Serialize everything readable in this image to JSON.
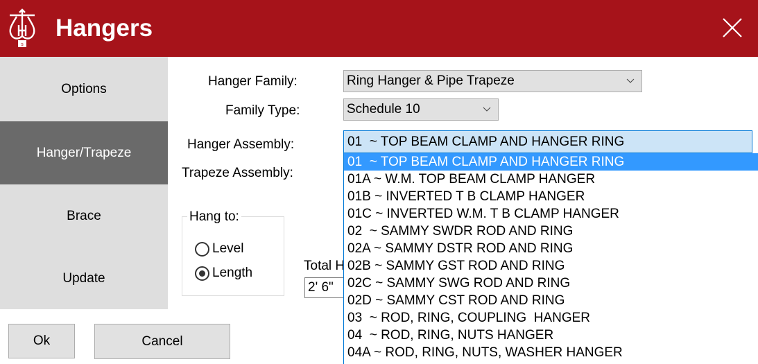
{
  "window": {
    "title": "Hangers",
    "logo_icon": "hanger-logo-icon",
    "close_icon": "close-icon",
    "accent_color": "#a6131a"
  },
  "sidebar": {
    "items": [
      {
        "label": "Options",
        "active": false
      },
      {
        "label": "Hanger/Trapeze",
        "active": true
      },
      {
        "label": "Brace",
        "active": false
      },
      {
        "label": "Update",
        "active": false
      }
    ]
  },
  "form": {
    "hanger_family": {
      "label": "Hanger Family:",
      "value": "Ring Hanger & Pipe Trapeze"
    },
    "family_type": {
      "label": "Family Type:",
      "value": "Schedule 10"
    },
    "hanger_assembly": {
      "label": "Hanger Assembly:",
      "value": "01  ~ TOP BEAM CLAMP AND HANGER RING",
      "options": [
        "01  ~ TOP BEAM CLAMP AND HANGER RING",
        "01A ~ W.M. TOP BEAM CLAMP HANGER",
        "01B ~ INVERTED T B CLAMP HANGER",
        "01C ~ INVERTED W.M. T B CLAMP HANGER",
        "02  ~ SAMMY SWDR ROD AND RING",
        "02A ~ SAMMY DSTR ROD AND RING",
        "02B ~ SAMMY GST ROD AND RING",
        "02C ~ SAMMY SWG ROD AND RING",
        "02D ~ SAMMY CST ROD AND RING",
        "03  ~ ROD, RING, COUPLING  HANGER",
        "04  ~ ROD, RING, NUTS HANGER",
        "04A ~ ROD, RING, NUTS, WASHER HANGER"
      ],
      "selected_index": 0
    },
    "trapeze_assembly": {
      "label": "Trapeze Assembly:"
    },
    "hang_to": {
      "title": "Hang to:",
      "options": [
        {
          "label": "Level",
          "checked": false
        },
        {
          "label": "Length",
          "checked": true
        }
      ]
    },
    "total_height": {
      "label": "Total H",
      "value": "2'  6\""
    }
  },
  "buttons": {
    "ok": "Ok",
    "cancel": "Cancel"
  }
}
